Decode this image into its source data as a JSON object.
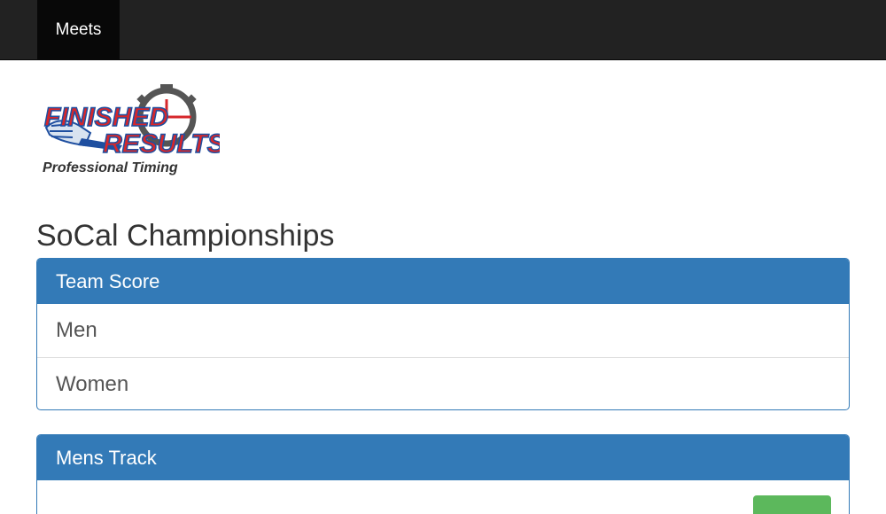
{
  "navbar": {
    "meets_label": "Meets"
  },
  "logo": {
    "line1": "FINISHED",
    "line2": "RESULTS",
    "tagline": "Professional Timing"
  },
  "page": {
    "title": "SoCal Championships"
  },
  "panels": {
    "team_score": {
      "heading": "Team Score",
      "items": [
        {
          "label": "Men"
        },
        {
          "label": "Women"
        }
      ]
    },
    "mens_track": {
      "heading": "Mens Track"
    }
  },
  "colors": {
    "navbar_bg": "#222222",
    "primary": "#337ab7",
    "success": "#5cb85c"
  }
}
